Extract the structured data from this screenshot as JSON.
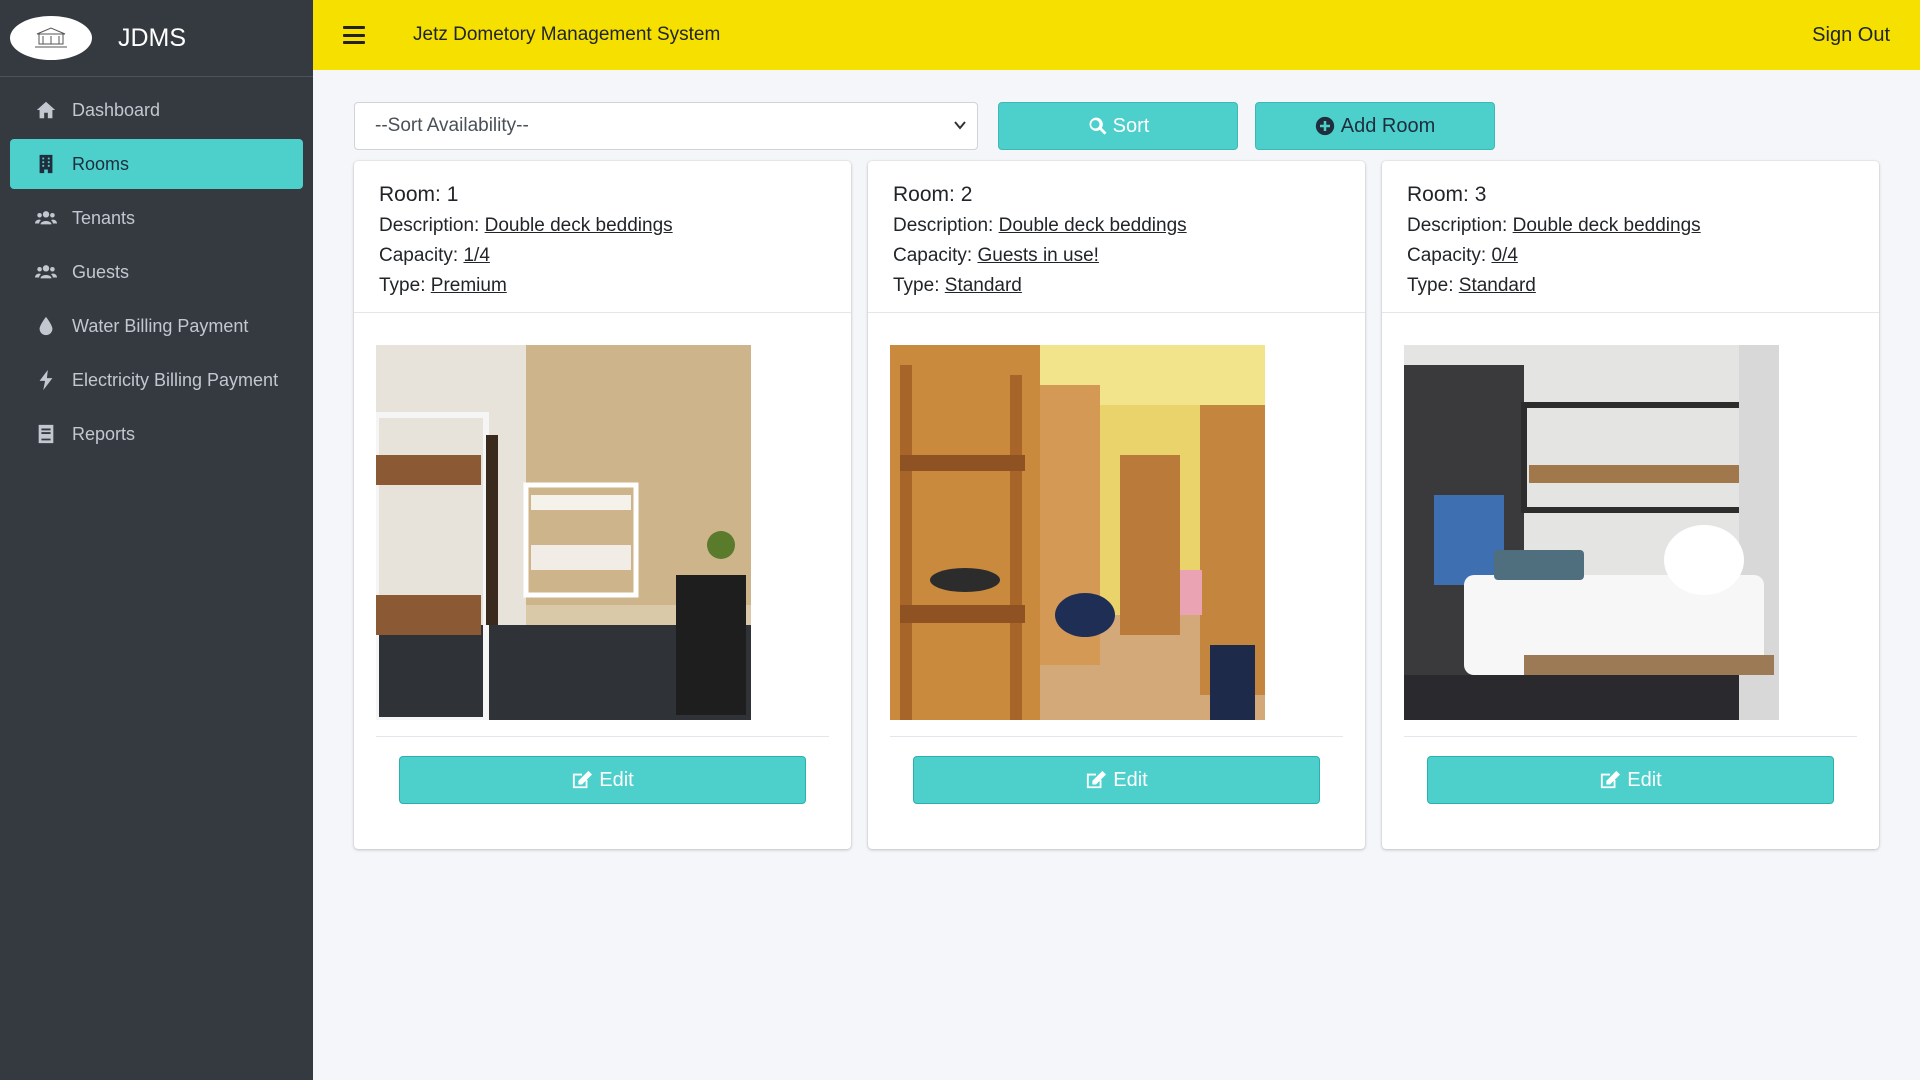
{
  "brand": {
    "name": "JDMS"
  },
  "topbar": {
    "title": "Jetz Dometory Management System",
    "signout_label": "Sign Out"
  },
  "sidebar": {
    "items": [
      {
        "label": "Dashboard",
        "icon": "home-icon"
      },
      {
        "label": "Rooms",
        "icon": "building-icon",
        "active": true
      },
      {
        "label": "Tenants",
        "icon": "users-icon"
      },
      {
        "label": "Guests",
        "icon": "users-icon"
      },
      {
        "label": "Water Billing Payment",
        "icon": "water-drop-icon"
      },
      {
        "label": "Electricity Billing Payment",
        "icon": "bolt-icon"
      },
      {
        "label": "Reports",
        "icon": "report-icon"
      }
    ]
  },
  "controls": {
    "sort_select_value": "--Sort Availability--",
    "sort_button_label": "Sort",
    "add_room_label": "Add Room"
  },
  "rooms": [
    {
      "room_label": "Room:",
      "room_no": "1",
      "description_label": "Description:",
      "description": "Double deck beddings",
      "capacity_label": "Capacity:",
      "capacity": "1/4",
      "type_label": "Type:",
      "type": "Premium",
      "edit_label": "Edit"
    },
    {
      "room_label": "Room:",
      "room_no": "2",
      "description_label": "Description:",
      "description": "Double deck beddings",
      "capacity_label": "Capacity:",
      "capacity": "Guests in use!",
      "type_label": "Type:",
      "type": "Standard",
      "edit_label": "Edit"
    },
    {
      "room_label": "Room:",
      "room_no": "3",
      "description_label": "Description:",
      "description": "Double deck beddings",
      "capacity_label": "Capacity:",
      "capacity": "0/4",
      "type_label": "Type:",
      "type": "Standard",
      "edit_label": "Edit"
    }
  ],
  "colors": {
    "sidebar": "#343a40",
    "topbar": "#f5e000",
    "accent": "#4dd0cc"
  }
}
